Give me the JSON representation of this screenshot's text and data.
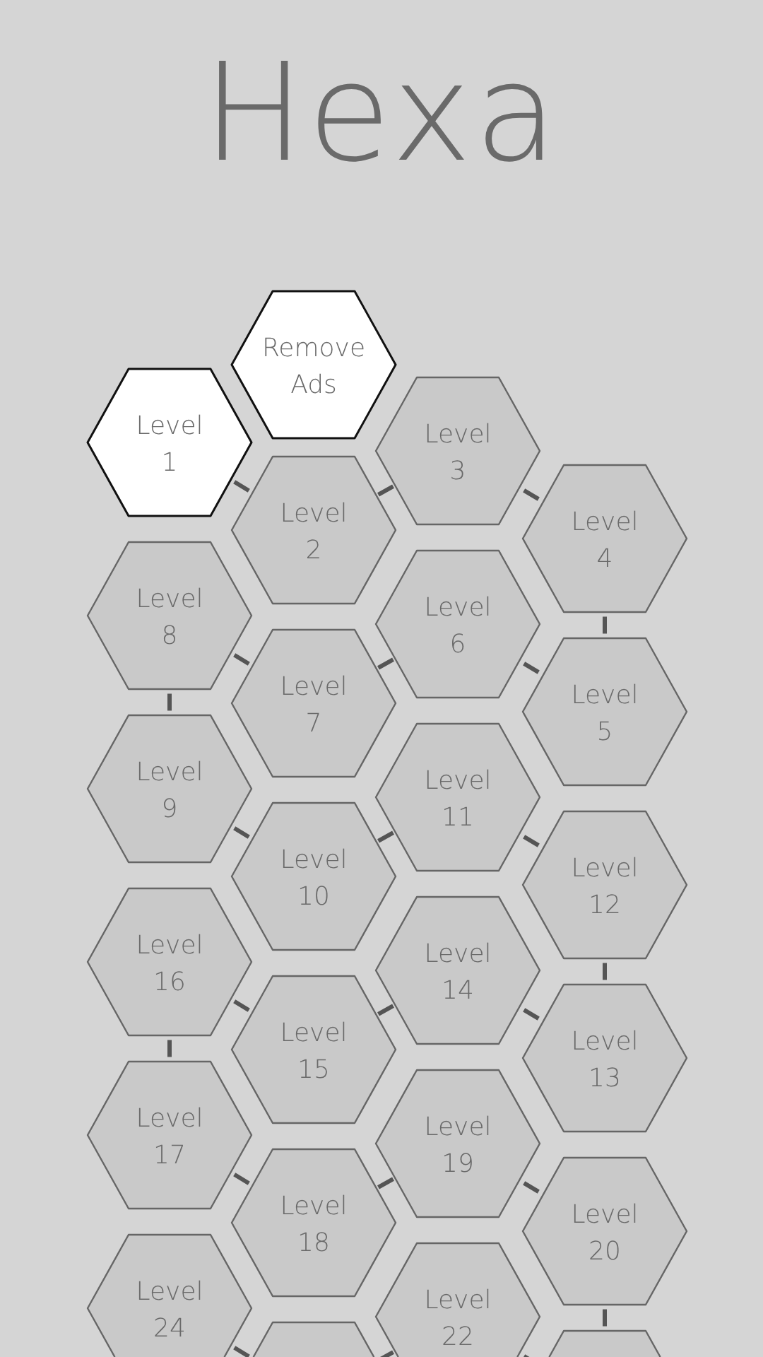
{
  "title": "Hexa",
  "remove_ads": {
    "label": "Remove",
    "label_2": "Ads"
  },
  "levels": [
    {
      "label": "Level",
      "number": "1",
      "unlocked": true
    },
    {
      "label": "Level",
      "number": "2",
      "unlocked": false
    },
    {
      "label": "Level",
      "number": "3",
      "unlocked": false
    },
    {
      "label": "Level",
      "number": "4",
      "unlocked": false
    },
    {
      "label": "Level",
      "number": "5",
      "unlocked": false
    },
    {
      "label": "Level",
      "number": "6",
      "unlocked": false
    },
    {
      "label": "Level",
      "number": "7",
      "unlocked": false
    },
    {
      "label": "Level",
      "number": "8",
      "unlocked": false
    },
    {
      "label": "Level",
      "number": "9",
      "unlocked": false
    },
    {
      "label": "Level",
      "number": "10",
      "unlocked": false
    },
    {
      "label": "Level",
      "number": "11",
      "unlocked": false
    },
    {
      "label": "Level",
      "number": "12",
      "unlocked": false
    },
    {
      "label": "Level",
      "number": "13",
      "unlocked": false
    },
    {
      "label": "Level",
      "number": "14",
      "unlocked": false
    },
    {
      "label": "Level",
      "number": "15",
      "unlocked": false
    },
    {
      "label": "Level",
      "number": "16",
      "unlocked": false
    },
    {
      "label": "Level",
      "number": "17",
      "unlocked": false
    },
    {
      "label": "Level",
      "number": "18",
      "unlocked": false
    },
    {
      "label": "Level",
      "number": "19",
      "unlocked": false
    },
    {
      "label": "Level",
      "number": "20",
      "unlocked": false
    },
    {
      "unlocked": false
    },
    {
      "label": "Level",
      "number": "22",
      "unlocked": false
    },
    {
      "unlocked": false
    },
    {
      "label": "Level",
      "number": "24",
      "unlocked": false
    }
  ]
}
